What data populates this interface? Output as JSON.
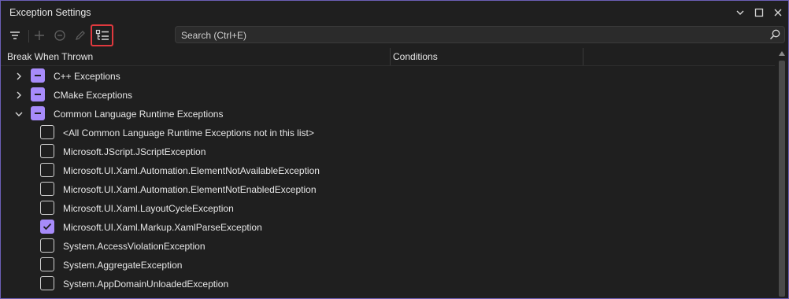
{
  "window": {
    "title": "Exception Settings"
  },
  "search": {
    "placeholder": "Search (Ctrl+E)"
  },
  "columns": {
    "break_when_thrown": "Break When Thrown",
    "conditions": "Conditions"
  },
  "colors": {
    "accent": "#a78bfa",
    "highlight": "#e0393e",
    "window_border": "#6b5fb5"
  },
  "toolbar": {
    "icons": [
      "filter-icon",
      "add-icon",
      "remove-icon",
      "edit-icon",
      "show-only-enabled-icon"
    ]
  },
  "rows": [
    {
      "label": "C++ Exceptions",
      "level": 0,
      "expanded": false,
      "state": "partial"
    },
    {
      "label": "CMake Exceptions",
      "level": 0,
      "expanded": false,
      "state": "partial"
    },
    {
      "label": "Common Language Runtime Exceptions",
      "level": 0,
      "expanded": true,
      "state": "partial"
    },
    {
      "label": "<All Common Language Runtime Exceptions not in this list>",
      "level": 1,
      "state": "unchecked"
    },
    {
      "label": "Microsoft.JScript.JScriptException",
      "level": 1,
      "state": "unchecked"
    },
    {
      "label": "Microsoft.UI.Xaml.Automation.ElementNotAvailableException",
      "level": 1,
      "state": "unchecked"
    },
    {
      "label": "Microsoft.UI.Xaml.Automation.ElementNotEnabledException",
      "level": 1,
      "state": "unchecked"
    },
    {
      "label": "Microsoft.UI.Xaml.LayoutCycleException",
      "level": 1,
      "state": "unchecked"
    },
    {
      "label": "Microsoft.UI.Xaml.Markup.XamlParseException",
      "level": 1,
      "state": "checked"
    },
    {
      "label": "System.AccessViolationException",
      "level": 1,
      "state": "unchecked"
    },
    {
      "label": "System.AggregateException",
      "level": 1,
      "state": "unchecked"
    },
    {
      "label": "System.AppDomainUnloadedException",
      "level": 1,
      "state": "unchecked"
    }
  ]
}
